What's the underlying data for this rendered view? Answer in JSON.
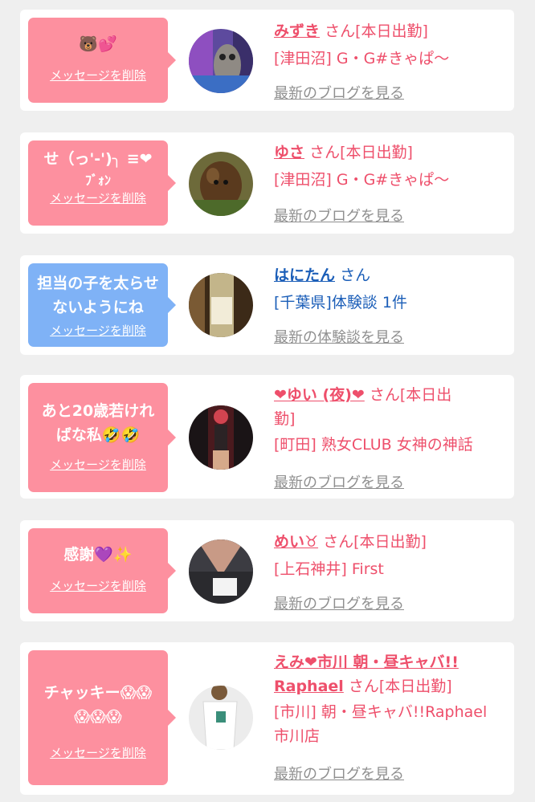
{
  "cards": [
    {
      "message": "🐻💕",
      "delete_label": "メッセージを削除",
      "name": "みずき",
      "san": "さん[本日出勤]",
      "shop": "[津田沼] G・G#きゃぱ〜",
      "link": "最新のブログを見る",
      "bubble_color": "#fd909f"
    },
    {
      "message_line1": "せ（っ'-')╮ ≡❤",
      "message_line2": "ﾌﾞｫﾝ",
      "delete_label": "メッセージを削除",
      "name": "ゆさ",
      "san": "さん[本日出勤]",
      "shop": "[津田沼] G・G#きゃぱ〜",
      "link": "最新のブログを見る",
      "bubble_color": "#fd909f"
    },
    {
      "message_line1": "担当の子を太らせ",
      "message_line2": "ないようにね",
      "delete_label": "メッセージを削除",
      "name": "はにたん",
      "san": "さん",
      "shop": "[千葉県]体験談 1件",
      "link": "最新の体験談を見る",
      "bubble_color": "#7fb2f6"
    },
    {
      "message_line1": "あと20歳若けれ",
      "message_line2": "ばな私🤣🤣",
      "delete_label": "メッセージを削除",
      "name": "❤ゆい (夜)❤",
      "san": "さん[本日出",
      "san_cont": "勤]",
      "shop": "[町田] 熟女CLUB 女神の神話",
      "link": "最新のブログを見る",
      "bubble_color": "#fd909f"
    },
    {
      "message": "感謝💜✨",
      "delete_label": "メッセージを削除",
      "name": "めい♉",
      "san": "さん[本日出勤]",
      "shop": "[上石神井] First",
      "link": "最新のブログを見る",
      "bubble_color": "#fd909f"
    },
    {
      "message_line1": "チャッキー😱😱",
      "message_line2": "😱😱😱",
      "delete_label": "メッセージを削除",
      "name_line1": "えみ❤市川 朝・昼キャバ!!",
      "name_line2": "Raphael",
      "san": "さん[本日出勤]",
      "shop_line1": "[市川] 朝・昼キャバ!!Raphael",
      "shop_line2": "市川店",
      "link": "最新のブログを見る",
      "bubble_color": "#fd909f"
    }
  ]
}
